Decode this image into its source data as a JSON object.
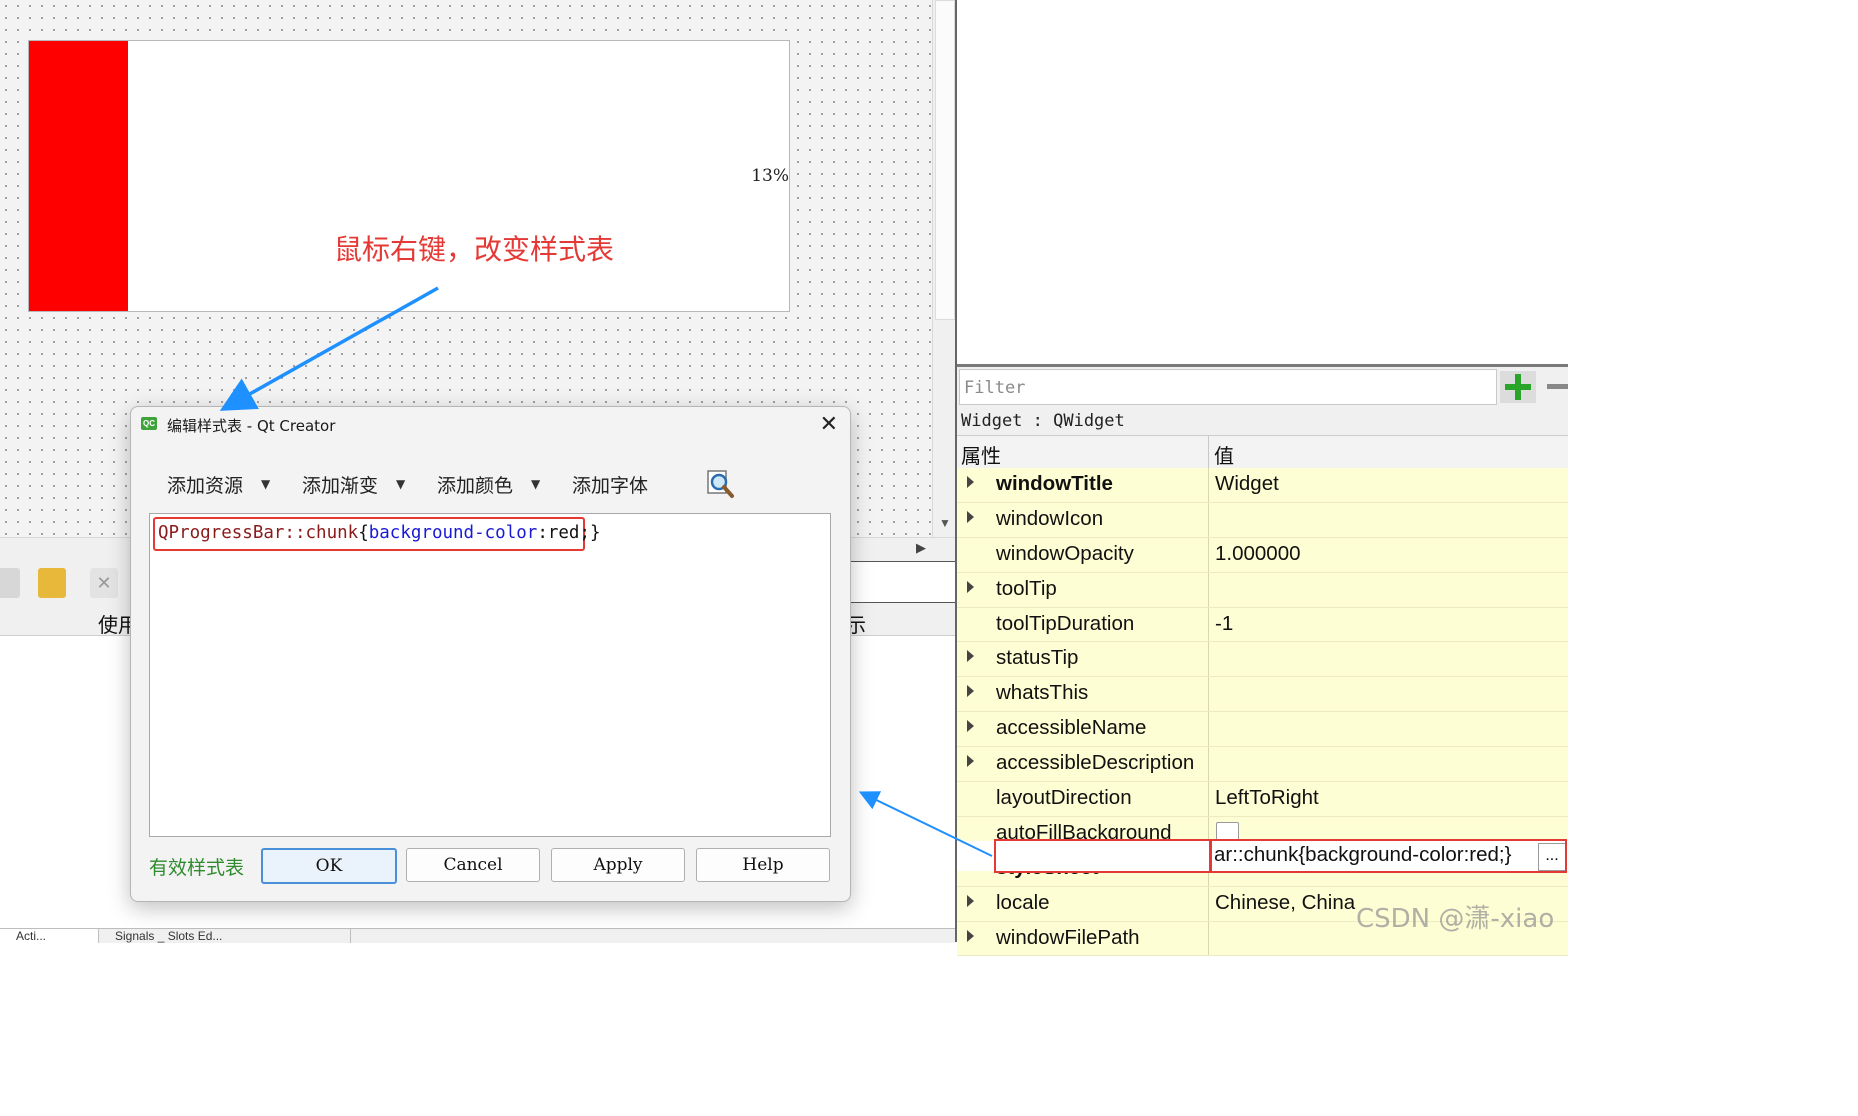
{
  "canvas": {
    "progress_percent_value": 13,
    "progress_label": "13%",
    "annotation": "鼠标右键，改变样式表"
  },
  "dock": {
    "header_col1": "使用",
    "header_col2": "示",
    "tabs": [
      "Acti...",
      "Signals _ Slots Ed..."
    ]
  },
  "dialog": {
    "title": "编辑样式表 - Qt Creator",
    "icon_text": "QC",
    "toolbar": [
      {
        "label": "添加资源",
        "has_dropdown": true
      },
      {
        "label": "添加渐变",
        "has_dropdown": true
      },
      {
        "label": "添加颜色",
        "has_dropdown": true
      },
      {
        "label": "添加字体",
        "has_dropdown": false
      }
    ],
    "code": {
      "selector": "QProgressBar::chunk",
      "open_brace": "{",
      "property": "background-color",
      "colon": ":",
      "value": "red;",
      "close_brace": "}"
    },
    "status": "有效样式表",
    "buttons": {
      "ok": "OK",
      "cancel": "Cancel",
      "apply": "Apply",
      "help": "Help"
    }
  },
  "property_editor": {
    "filter_placeholder": "Filter",
    "class_label": "Widget : QWidget",
    "header": {
      "property": "属性",
      "value": "值"
    },
    "rows": [
      {
        "name": "windowTitle",
        "value": "Widget",
        "bold": true,
        "expandable": true
      },
      {
        "name": "windowIcon",
        "value": "",
        "bold": false,
        "expandable": true
      },
      {
        "name": "windowOpacity",
        "value": "1.000000",
        "bold": false,
        "expandable": false
      },
      {
        "name": "toolTip",
        "value": "",
        "bold": false,
        "expandable": true
      },
      {
        "name": "toolTipDuration",
        "value": "-1",
        "bold": false,
        "expandable": false
      },
      {
        "name": "statusTip",
        "value": "",
        "bold": false,
        "expandable": true
      },
      {
        "name": "whatsThis",
        "value": "",
        "bold": false,
        "expandable": true
      },
      {
        "name": "accessibleName",
        "value": "",
        "bold": false,
        "expandable": true
      },
      {
        "name": "accessibleDescription",
        "value": "",
        "bold": false,
        "expandable": true
      },
      {
        "name": "layoutDirection",
        "value": "LeftToRight",
        "bold": false,
        "expandable": false
      },
      {
        "name": "autoFillBackground",
        "value": "",
        "bold": false,
        "expandable": false,
        "checkbox": true
      },
      {
        "name": "styleSheet",
        "value": "ar::chunk{background-color:red;}",
        "bold": true,
        "expandable": false
      },
      {
        "name": "locale",
        "value": "Chinese, China",
        "bold": false,
        "expandable": true
      },
      {
        "name": "windowFilePath",
        "value": "",
        "bold": false,
        "expandable": true
      }
    ],
    "stylesheet_button": "..."
  },
  "watermark": "CSDN @潇-xiao",
  "colors": {
    "chunk": "#ff0000",
    "annotation": "#e53935",
    "highlight_border": "#e53935",
    "valid_text": "#2e8b2e",
    "arrow": "#1e90ff",
    "property_bg": "#fefed4"
  }
}
